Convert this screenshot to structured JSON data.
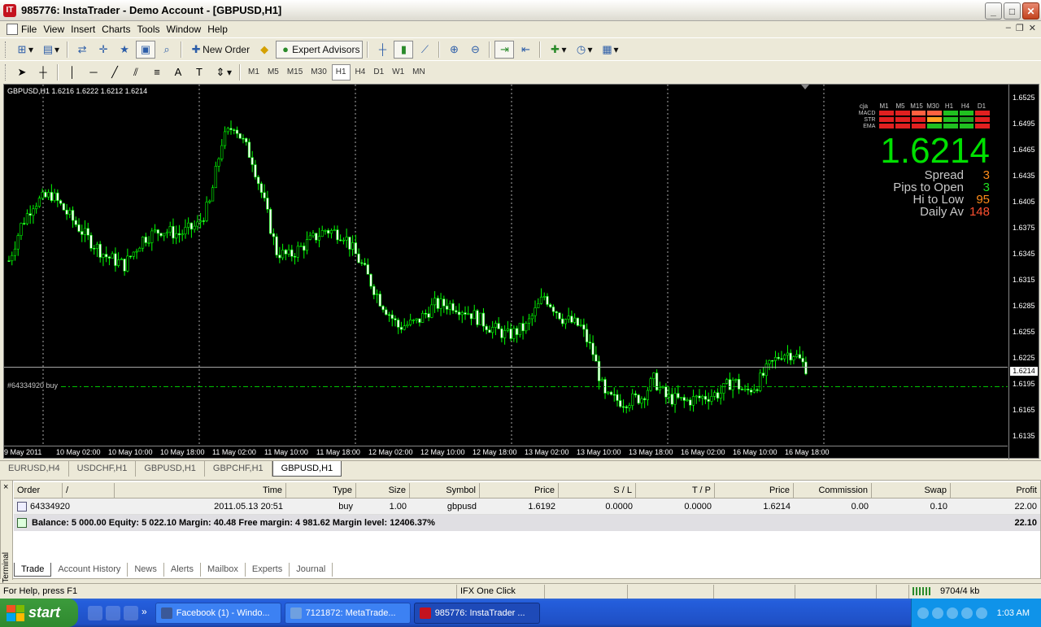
{
  "window": {
    "title": "985776: InstaTrader - Demo Account - [GBPUSD,H1]",
    "app_icon": "IT"
  },
  "menu": [
    "File",
    "View",
    "Insert",
    "Charts",
    "Tools",
    "Window",
    "Help"
  ],
  "toolbar": {
    "new_order": "New Order",
    "expert_advisors": "Expert Advisors"
  },
  "timeframes": [
    "M1",
    "M5",
    "M15",
    "M30",
    "H1",
    "H4",
    "D1",
    "W1",
    "MN"
  ],
  "active_timeframe": "H1",
  "chart": {
    "info": "GBPUSD,H1  1.6216 1.6222 1.6212 1.6214",
    "order_label": "#64334920 buy",
    "last_price_tag": "1.6214",
    "y_ticks": [
      "1.6525",
      "1.6495",
      "1.6465",
      "1.6435",
      "1.6405",
      "1.6375",
      "1.6345",
      "1.6315",
      "1.6285",
      "1.6255",
      "1.6225",
      "1.6195",
      "1.6165",
      "1.6135"
    ],
    "x_ticks": [
      "9 May 2011",
      "10 May 02:00",
      "10 May 10:00",
      "10 May 18:00",
      "11 May 02:00",
      "11 May 10:00",
      "11 May 18:00",
      "12 May 02:00",
      "12 May 10:00",
      "12 May 18:00",
      "13 May 02:00",
      "13 May 10:00",
      "13 May 18:00",
      "16 May 02:00",
      "16 May 10:00",
      "16 May 18:00"
    ],
    "candle_color": "#ffffff",
    "wick_color": "#00ff00",
    "ylim": [
      1.6125,
      1.6535
    ],
    "current_price": 1.6214,
    "order_price": 1.6192
  },
  "indicator": {
    "label": "cja",
    "frames": [
      "M1",
      "M5",
      "M15",
      "M30",
      "H1",
      "H4",
      "D1"
    ],
    "rows": [
      {
        "name": "MACD",
        "colors": [
          "#e02020",
          "#e02020",
          "#ff6040",
          "#ff6040",
          "#20c020",
          "#20c020",
          "#e02020"
        ]
      },
      {
        "name": "STR",
        "colors": [
          "#e02020",
          "#e02020",
          "#e02020",
          "#ffa020",
          "#20c020",
          "#20a020",
          "#e02020"
        ]
      },
      {
        "name": "EMA",
        "colors": [
          "#e02020",
          "#e02020",
          "#e02020",
          "#20c020",
          "#20c020",
          "#20c020",
          "#e02020"
        ]
      }
    ],
    "price": "1.6214",
    "stats": [
      {
        "label": "Spread",
        "value": "3",
        "color": "#ff8c1a"
      },
      {
        "label": "Pips to Open",
        "value": "3",
        "color": "#20e020"
      },
      {
        "label": "Hi to Low",
        "value": "95",
        "color": "#ff8c1a"
      },
      {
        "label": "Daily Av",
        "value": "148",
        "color": "#ff5030"
      }
    ]
  },
  "chart_tabs": [
    "EURUSD,H4",
    "USDCHF,H1",
    "GBPUSD,H1",
    "GBPCHF,H1",
    "GBPUSD,H1"
  ],
  "active_chart_tab": 4,
  "terminal": {
    "side_label": "Terminal",
    "close": "×",
    "columns": [
      "Order",
      "/",
      "Time",
      "Type",
      "Size",
      "Symbol",
      "Price",
      "S / L",
      "T / P",
      "Price",
      "Commission",
      "Swap",
      "Profit"
    ],
    "row": {
      "order": "64334920",
      "time": "2011.05.13 20:51",
      "type": "buy",
      "size": "1.00",
      "symbol": "gbpusd",
      "price": "1.6192",
      "sl": "0.0000",
      "tp": "0.0000",
      "cur_price": "1.6214",
      "commission": "0.00",
      "swap": "0.10",
      "profit": "22.00"
    },
    "balance": "Balance: 5 000.00  Equity: 5 022.10  Margin: 40.48  Free margin: 4 981.62  Margin level: 12406.37%",
    "total": "22.10",
    "tabs": [
      "Trade",
      "Account History",
      "News",
      "Alerts",
      "Mailbox",
      "Experts",
      "Journal"
    ]
  },
  "status": {
    "help": "For Help, press F1",
    "mode": "IFX One Click Trading",
    "traffic": "9704/4 kb"
  },
  "taskbar": {
    "start": "start",
    "tasks": [
      {
        "label": "Facebook (1) - Windo...",
        "color": "#3b5998"
      },
      {
        "label": "7121872: MetaTrade...",
        "color": "#6fa0e0"
      },
      {
        "label": "985776: InstaTrader ...",
        "color": "#c4131f"
      }
    ],
    "active_task": 2,
    "clock": "1:03 AM"
  }
}
